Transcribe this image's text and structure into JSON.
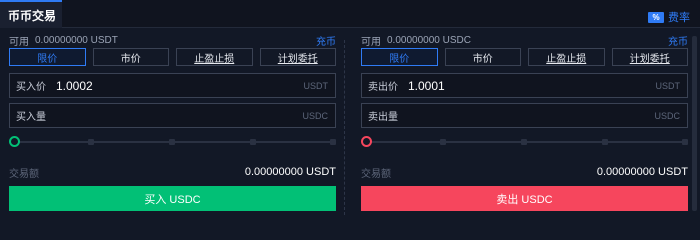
{
  "header": {
    "tab_label": "币币交易",
    "rate_icon": "%",
    "rate_label": "费率"
  },
  "colors": {
    "accent": "#2f7bf5",
    "buy": "#02c076",
    "sell": "#f6465d",
    "background": "#121826"
  },
  "buy": {
    "available_label": "可用",
    "available_value": "0.00000000 USDT",
    "deposit_link": "充币",
    "order_types": [
      "限价",
      "市价",
      "止盈止损",
      "计划委托"
    ],
    "active_order_type": "限价",
    "price_label": "买入价",
    "price_value": "1.0002",
    "price_unit": "USDT",
    "amount_label": "买入量",
    "amount_unit": "USDC",
    "slider_percent": 0,
    "total_label": "交易额",
    "total_value": "0.00000000 USDT",
    "button_label": "买入 USDC"
  },
  "sell": {
    "available_label": "可用",
    "available_value": "0.00000000 USDC",
    "deposit_link": "充币",
    "order_types": [
      "限价",
      "市价",
      "止盈止损",
      "计划委托"
    ],
    "active_order_type": "限价",
    "price_label": "卖出价",
    "price_value": "1.0001",
    "price_unit": "USDT",
    "amount_label": "卖出量",
    "amount_unit": "USDC",
    "slider_percent": 0,
    "total_label": "交易额",
    "total_value": "0.00000000 USDT",
    "button_label": "卖出 USDC"
  }
}
